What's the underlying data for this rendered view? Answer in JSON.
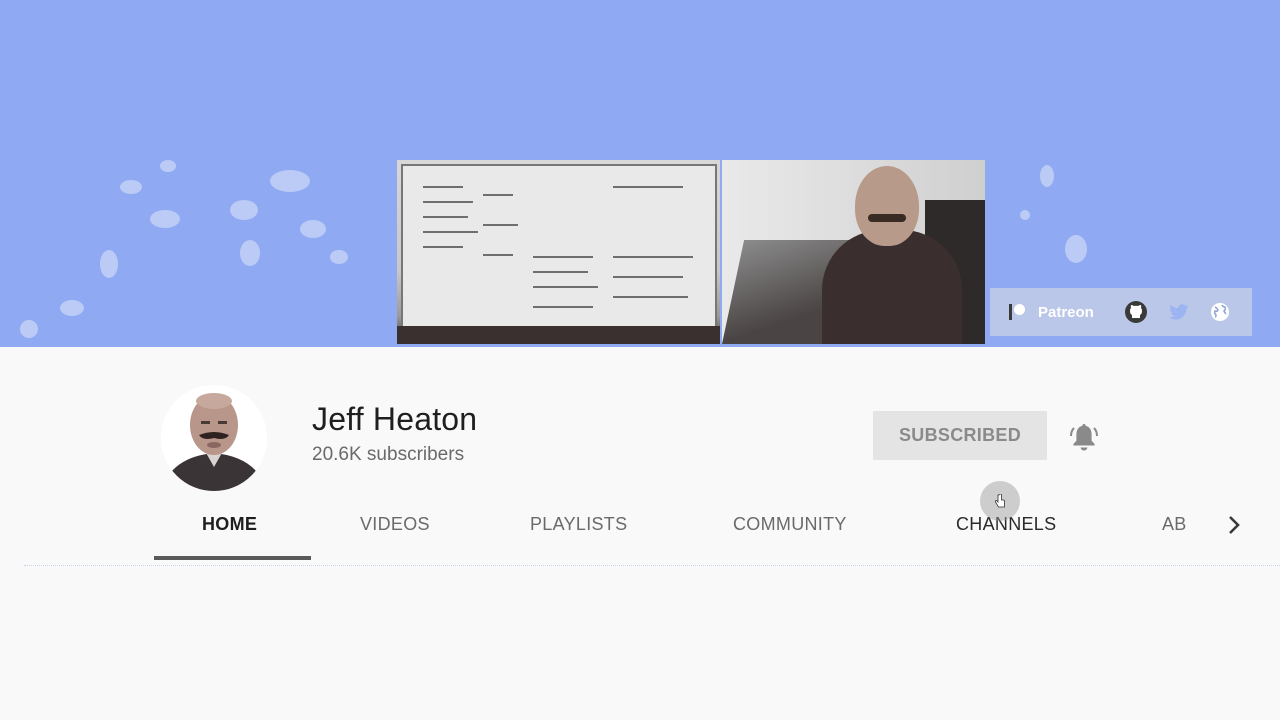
{
  "banner": {
    "social_links": [
      {
        "label": "Patreon",
        "icon": "patreon-icon"
      },
      {
        "label": "",
        "icon": "github-icon"
      },
      {
        "label": "",
        "icon": "twitter-icon"
      },
      {
        "label": "",
        "icon": "globe-icon"
      }
    ]
  },
  "channel": {
    "name": "Jeff Heaton",
    "subscribers": "20.6K subscribers",
    "subscribe_button_label": "SUBSCRIBED",
    "bell_icon": "bell-icon"
  },
  "tabs": {
    "items": [
      {
        "label": "HOME",
        "active": true
      },
      {
        "label": "VIDEOS",
        "active": false
      },
      {
        "label": "PLAYLISTS",
        "active": false
      },
      {
        "label": "COMMUNITY",
        "active": false
      },
      {
        "label": "CHANNELS",
        "active": false
      },
      {
        "label": "AB",
        "active": false
      }
    ],
    "next_icon": "chevron-right-icon"
  },
  "colors": {
    "banner_blue": "#8faaf3",
    "background": "#f9f9f9",
    "subscribed_bg": "#e4e4e4",
    "active_tab_underline": "#5a5a5a"
  }
}
